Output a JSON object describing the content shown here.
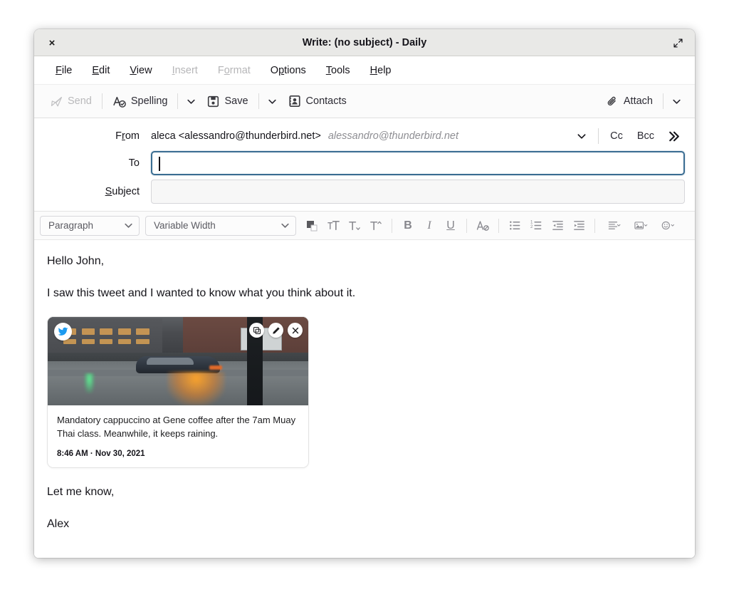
{
  "window": {
    "title": "Write: (no subject) - Daily",
    "close_label": "×",
    "maximize_icon": "maximize-icon"
  },
  "menubar": {
    "items": [
      {
        "label": "File",
        "accel": "F",
        "disabled": false
      },
      {
        "label": "Edit",
        "accel": "E",
        "disabled": false
      },
      {
        "label": "View",
        "accel": "V",
        "disabled": false
      },
      {
        "label": "Insert",
        "accel": "I",
        "disabled": true
      },
      {
        "label": "Format",
        "accel": "o",
        "disabled": true
      },
      {
        "label": "Options",
        "accel": "p",
        "disabled": false
      },
      {
        "label": "Tools",
        "accel": "T",
        "disabled": false
      },
      {
        "label": "Help",
        "accel": "H",
        "disabled": false
      }
    ]
  },
  "toolbar": {
    "send_label": "Send",
    "spelling_label": "Spelling",
    "save_label": "Save",
    "contacts_label": "Contacts",
    "attach_label": "Attach"
  },
  "compose": {
    "from_label": "From",
    "from_identity": "aleca <alessandro@thunderbird.net>",
    "from_email": "alessandro@thunderbird.net",
    "cc_label": "Cc",
    "bcc_label": "Bcc",
    "more_label": "»",
    "to_label": "To",
    "to_value": "",
    "subject_label": "Subject",
    "subject_value": ""
  },
  "format_toolbar": {
    "paragraph_value": "Paragraph",
    "font_value": "Variable Width",
    "color_swatch": "#5a5a5e"
  },
  "message_body": {
    "greeting": "Hello John,",
    "intro": "I saw this tweet and I wanted to know what you think about it.",
    "closing": "Let me know,",
    "signature": "Alex"
  },
  "tweet_card": {
    "text": "Mandatory cappuccino at Gene coffee after the 7am Muay Thai class. Meanwhile, it keeps raining.",
    "timestamp": "8:46 AM · Nov 30, 2021",
    "brand_color": "#1d9bf0"
  },
  "colors": {
    "titlebar_bg": "#e9e9e7",
    "focus_border": "#3a6d92",
    "accent": "#1d9bf0"
  }
}
